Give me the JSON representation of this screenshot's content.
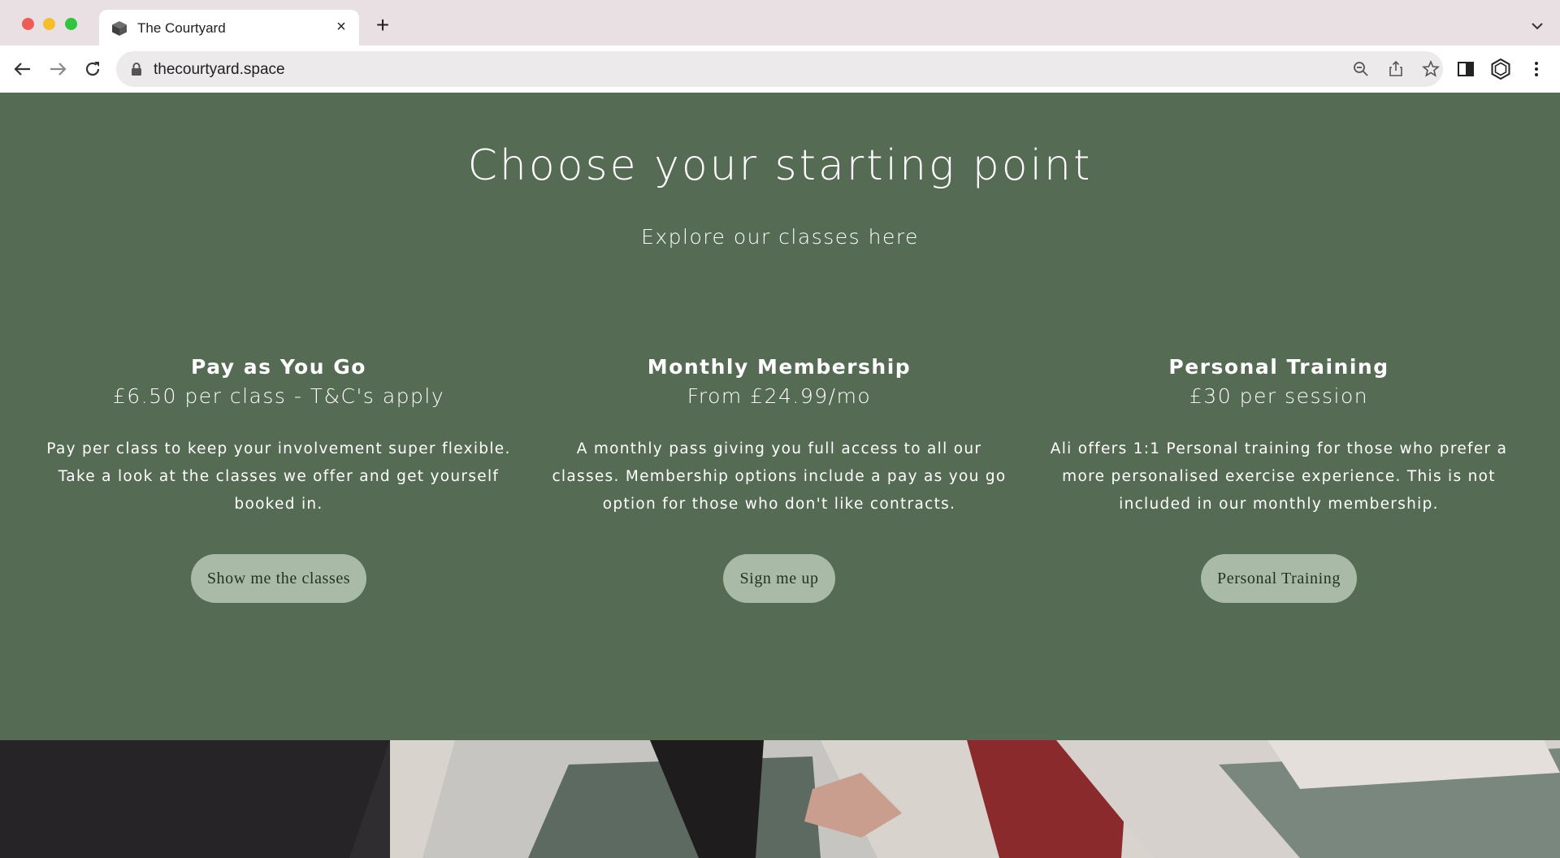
{
  "browser": {
    "tab_title": "The Courtyard",
    "url": "thecourtyard.space"
  },
  "hero": {
    "title": "Choose your starting point",
    "subtitle": "Explore our classes here"
  },
  "plans": [
    {
      "name": "Pay as You Go",
      "price": "£6.50 per class - T&C's apply",
      "description": "Pay per class to keep your involvement super flexible. Take a look at the classes we offer and get yourself booked in.",
      "button": "Show me the classes"
    },
    {
      "name": "Monthly Membership",
      "price": "From £24.99/mo",
      "description": "A monthly pass giving you full access to all our classes. Membership options include a pay as you go option for those who don't like contracts.",
      "button": "Sign me up"
    },
    {
      "name": "Personal Training",
      "price": "£30 per session",
      "description": "Ali offers 1:1 Personal training for those who prefer a more personalised exercise experience. This is not included in our monthly membership.",
      "button": "Personal Training"
    }
  ],
  "colors": {
    "hero_bg": "#556b53",
    "button_bg": "#a9bba7"
  }
}
